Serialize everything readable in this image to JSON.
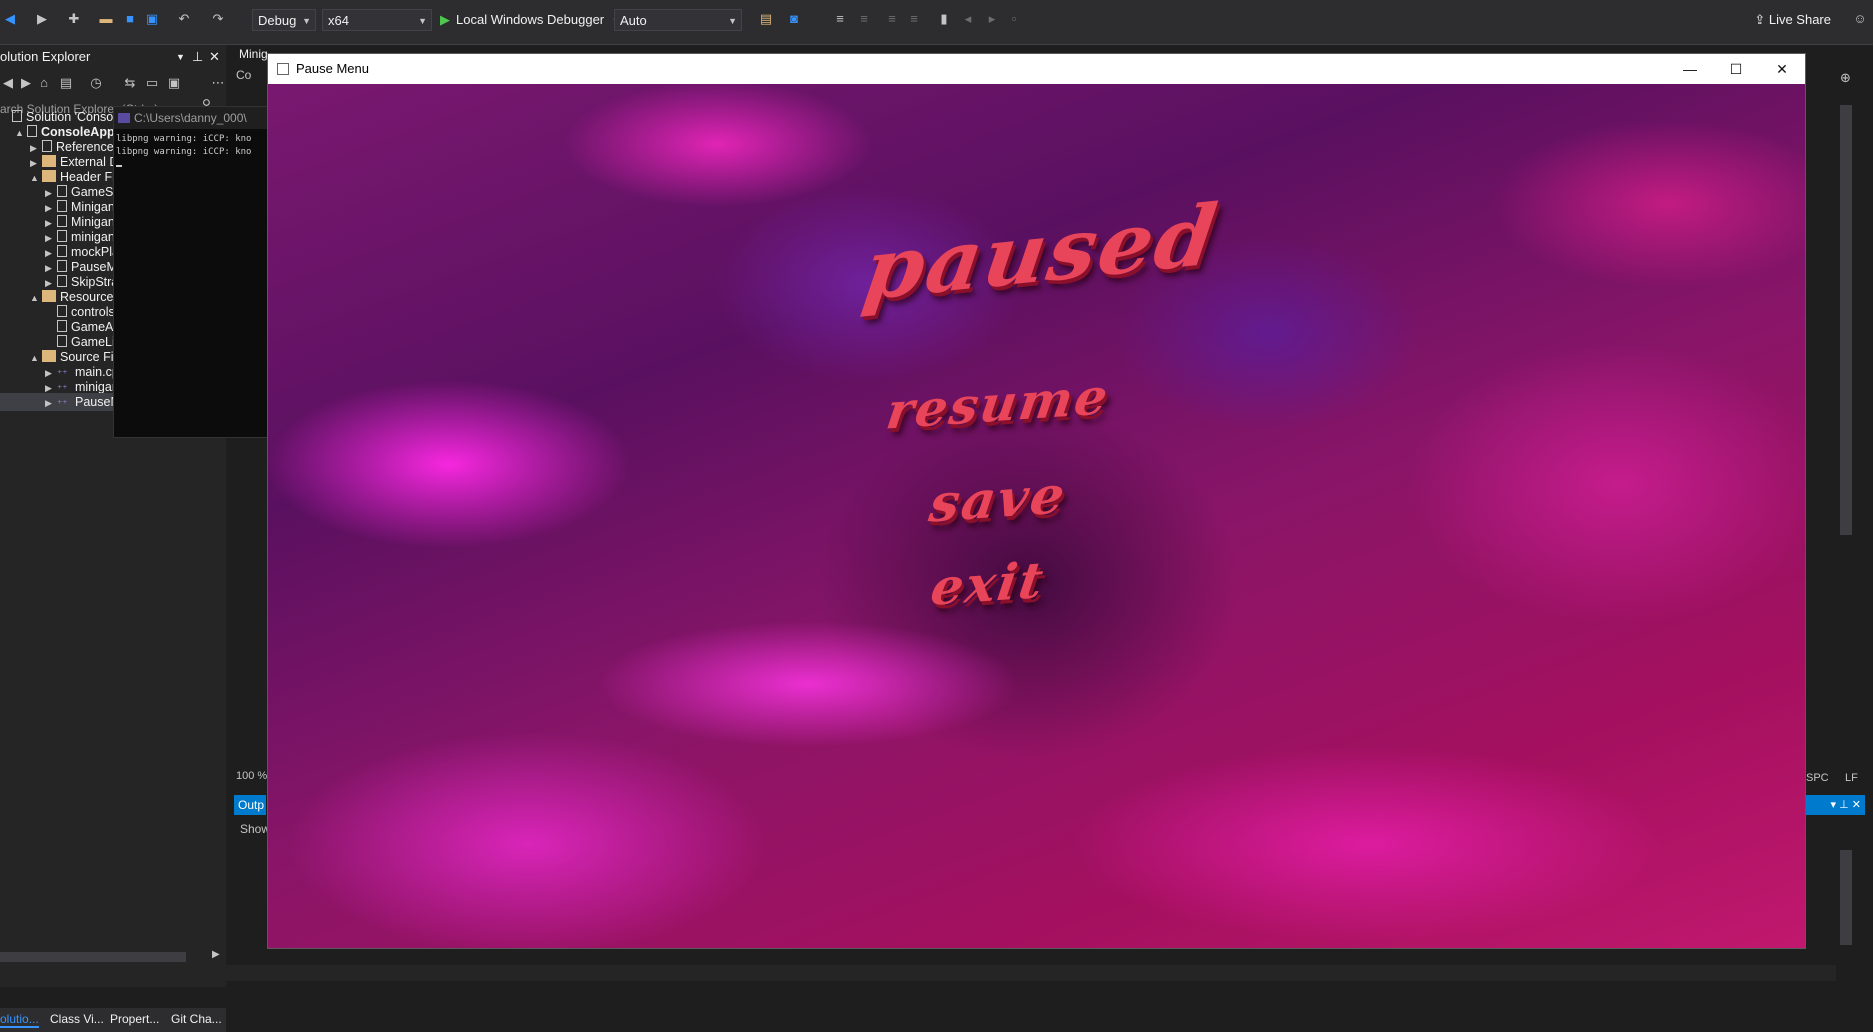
{
  "toolbar": {
    "config": "Debug",
    "platform": "x64",
    "debugger": "Local Windows Debugger",
    "solution_config": "Auto",
    "live_share": "Live Share"
  },
  "solution_explorer": {
    "title": "olution Explorer",
    "search_placeholder": "arch Solution Explorer (Ctrl+;)",
    "items": [
      {
        "label": "Solution 'ConsoleA",
        "indent": 0,
        "icon": "solution-icon",
        "expander": ""
      },
      {
        "label": "ConsoleApplica",
        "indent": 1,
        "icon": "project-icon",
        "expander": "▲",
        "bold": true
      },
      {
        "label": "References",
        "indent": 2,
        "icon": "references-icon",
        "expander": "▶"
      },
      {
        "label": "External Dep",
        "indent": 2,
        "icon": "folder-icon",
        "expander": "▶"
      },
      {
        "label": "Header Files",
        "indent": 2,
        "icon": "folder-icon",
        "expander": "▲"
      },
      {
        "label": "GameSt",
        "indent": 3,
        "icon": "header-file-icon",
        "expander": "▶"
      },
      {
        "label": "Minigan",
        "indent": 3,
        "icon": "header-file-icon",
        "expander": "▶"
      },
      {
        "label": "Minigan",
        "indent": 3,
        "icon": "header-file-icon",
        "expander": "▶"
      },
      {
        "label": "minigan",
        "indent": 3,
        "icon": "header-file-icon",
        "expander": "▶"
      },
      {
        "label": "mockPla",
        "indent": 3,
        "icon": "header-file-icon",
        "expander": "▶"
      },
      {
        "label": "PauseM",
        "indent": 3,
        "icon": "header-file-icon",
        "expander": "▶"
      },
      {
        "label": "SkipStrat",
        "indent": 3,
        "icon": "header-file-icon",
        "expander": "▶"
      },
      {
        "label": "Resource Fil",
        "indent": 2,
        "icon": "folder-icon",
        "expander": "▲"
      },
      {
        "label": "controls",
        "indent": 3,
        "icon": "resource-file-icon",
        "expander": ""
      },
      {
        "label": "GameAr",
        "indent": 3,
        "icon": "resource-file-icon",
        "expander": ""
      },
      {
        "label": "GameLis",
        "indent": 3,
        "icon": "resource-file-icon",
        "expander": ""
      },
      {
        "label": "Source Files",
        "indent": 2,
        "icon": "folder-icon",
        "expander": "▲"
      },
      {
        "label": "main.cpp",
        "indent": 3,
        "icon": "cpp-file-icon",
        "expander": "▶"
      },
      {
        "label": "minigameOptions.cpp",
        "indent": 3,
        "icon": "cpp-file-icon",
        "expander": "▶"
      },
      {
        "label": "PauseMenu.cpp",
        "indent": 3,
        "icon": "cpp-file-icon",
        "expander": "▶",
        "selected": true
      }
    ],
    "tabs": [
      "olutio...",
      "Class Vi...",
      "Propert...",
      "Git Cha..."
    ]
  },
  "console": {
    "title": "C:\\Users\\danny_000\\",
    "lines": [
      "libpng warning: iCCP: kno",
      "libpng warning: iCCP: kno"
    ]
  },
  "editor": {
    "tab": "Minig",
    "subtab": "Co",
    "zoom": "100 %",
    "output_tab": "Outp",
    "show_label": "Show",
    "encoding": "SPC",
    "line_ending": "LF"
  },
  "pause_window": {
    "title": "Pause Menu",
    "heading": "paused",
    "buttons": [
      "resume",
      "save",
      "exit"
    ]
  }
}
